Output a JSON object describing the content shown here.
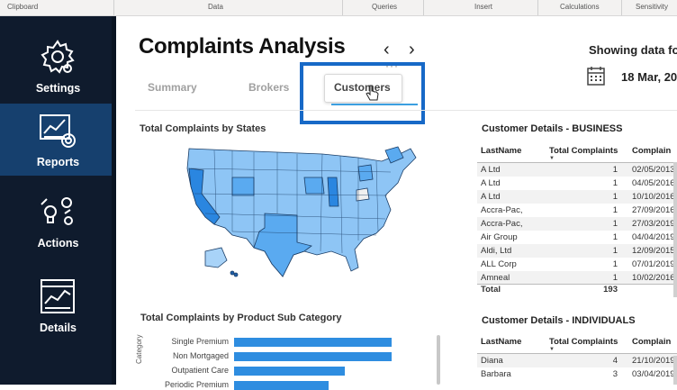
{
  "ribbon": {
    "groups": [
      "Clipboard",
      "Data",
      "Queries",
      "Insert",
      "Calculations",
      "Sensitivity"
    ]
  },
  "nav": {
    "items": [
      {
        "label": "Settings",
        "icon": "gear-icon"
      },
      {
        "label": "Reports",
        "icon": "report-icon",
        "active": true
      },
      {
        "label": "Actions",
        "icon": "actions-icon"
      },
      {
        "label": "Details",
        "icon": "details-icon"
      }
    ]
  },
  "header": {
    "title": "Complaints Analysis",
    "prev": "‹",
    "next": "›",
    "showing": "Showing data fo",
    "date": "18 Mar, 20",
    "more": "···"
  },
  "tabs": [
    "Summary",
    "Brokers",
    "Customers"
  ],
  "visuals": {
    "map_title": "Total Complaints by States",
    "bar_title": "Total Complaints by Product Sub Category",
    "bar_axis": "Category"
  },
  "colors": {
    "nav_bg": "#0f1b2d",
    "nav_active": "#16406e",
    "accent": "#1769c7",
    "bar": "#2e8de0",
    "map_light": "#8ec5f5",
    "map_mid": "#5aaaf0",
    "map_dark": "#2a86e0"
  },
  "chart_data": {
    "type": "bar",
    "title": "Total Complaints by Product Sub Category",
    "categories": [
      "Single Premium",
      "Non Mortgaged",
      "Outpatient Care",
      "Periodic Premium"
    ],
    "values": [
      100,
      100,
      70,
      60
    ],
    "ylabel": "Category",
    "xlabel": ""
  },
  "business": {
    "title": "Customer Details - BUSINESS",
    "headers": [
      "LastName",
      "Total Complaints",
      "Complain"
    ],
    "rows": [
      [
        "A Ltd",
        "1",
        "02/05/2013"
      ],
      [
        "A Ltd",
        "1",
        "04/05/2016"
      ],
      [
        "A Ltd",
        "1",
        "10/10/2016"
      ],
      [
        "Accra-Pac,",
        "1",
        "27/09/2016"
      ],
      [
        "Accra-Pac,",
        "1",
        "27/03/2019"
      ],
      [
        "Air Group",
        "1",
        "04/04/2019"
      ],
      [
        "Aldi, Ltd",
        "1",
        "12/09/2015"
      ],
      [
        "ALL Corp",
        "1",
        "07/01/2019"
      ],
      [
        "Amneal",
        "1",
        "10/02/2016"
      ]
    ],
    "total_label": "Total",
    "total_value": "193"
  },
  "individuals": {
    "title": "Customer Details - INDIVIDUALS",
    "headers": [
      "LastName",
      "Total Complaints",
      "Complain"
    ],
    "rows": [
      [
        "Diana",
        "4",
        "21/10/2019"
      ],
      [
        "Barbara",
        "3",
        "03/04/2019"
      ]
    ]
  }
}
